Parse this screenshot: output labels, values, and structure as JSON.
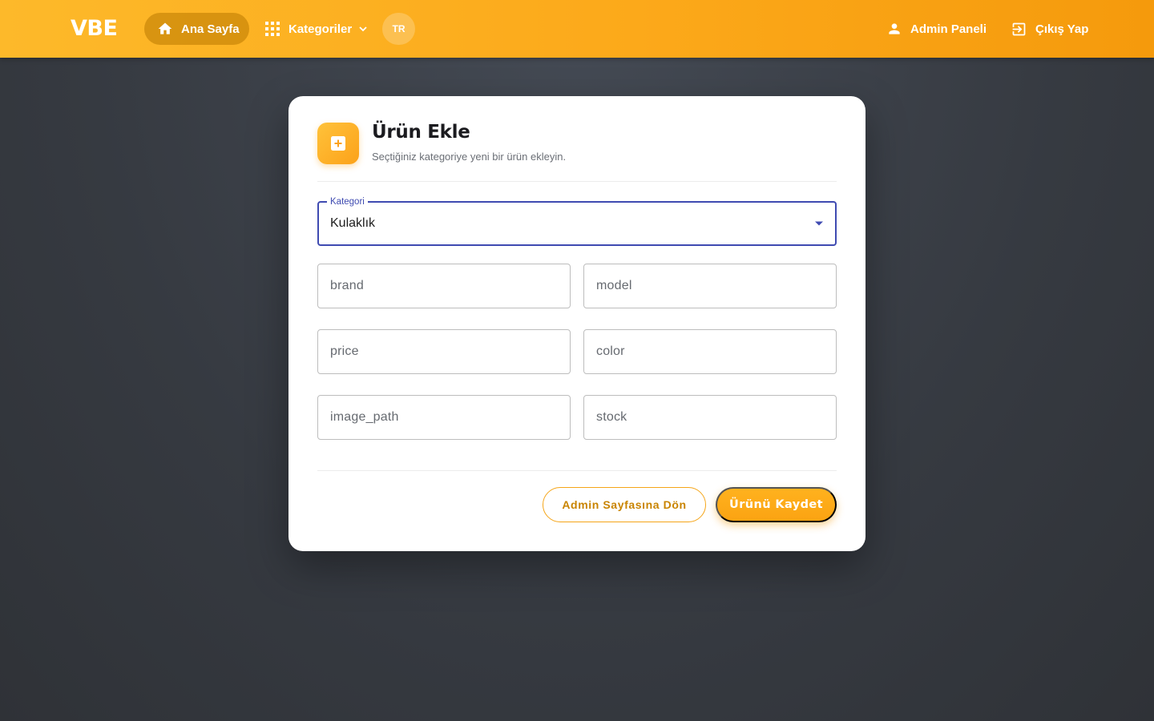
{
  "navbar": {
    "logo": "VBE",
    "home_label": "Ana Sayfa",
    "categories_label": "Kategoriler",
    "lang_label": "TR",
    "admin_label": "Admin Paneli",
    "logout_label": "Çıkış Yap"
  },
  "form": {
    "title": "Ürün Ekle",
    "subtitle": "Seçtiğiniz kategoriye yeni bir ürün ekleyin.",
    "category": {
      "label": "Kategori",
      "selected": "Kulaklık"
    },
    "fields": {
      "brand": {
        "placeholder": "brand",
        "value": ""
      },
      "model": {
        "placeholder": "model",
        "value": ""
      },
      "price": {
        "placeholder": "price",
        "value": ""
      },
      "color": {
        "placeholder": "color",
        "value": ""
      },
      "image_path": {
        "placeholder": "image_path",
        "value": ""
      },
      "stock": {
        "placeholder": "stock",
        "value": ""
      }
    },
    "back_button": "Admin Sayfasına Dön",
    "save_button": "Ürünü Kaydet"
  },
  "icons": {
    "home": "home-icon",
    "categories": "grid-icon",
    "chevron": "chevron-down-icon",
    "admin": "user-icon",
    "logout": "logout-icon",
    "add": "plus-square-icon",
    "select_arrow": "caret-down-icon"
  },
  "colors": {
    "accent": "#fca91a",
    "focus": "#3f4bb1",
    "background": "#363a41"
  }
}
